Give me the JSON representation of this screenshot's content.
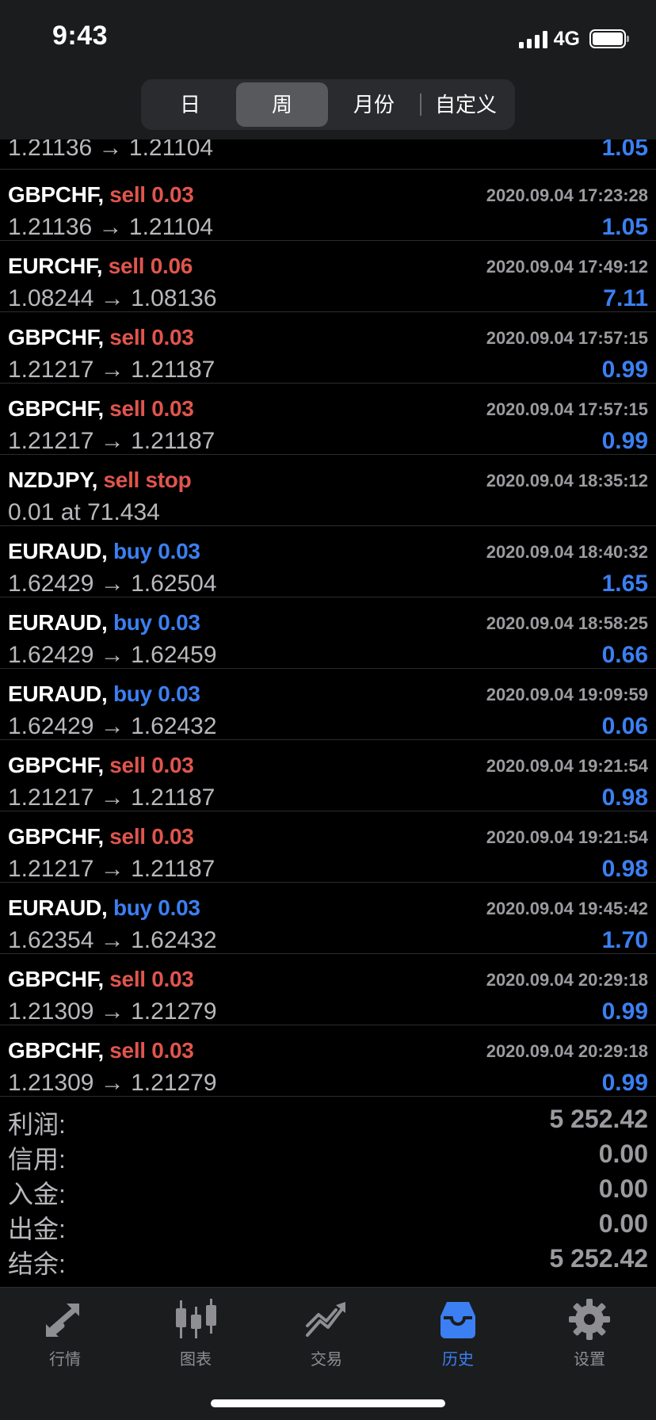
{
  "status_bar": {
    "time": "9:43",
    "network": "4G",
    "battery_level": 1.0
  },
  "period_tabs": {
    "selected": "周",
    "items": [
      {
        "label": "日"
      },
      {
        "label": "周"
      },
      {
        "label": "月份"
      },
      {
        "label": "自定义"
      }
    ]
  },
  "colors": {
    "sell": "#e0554d",
    "buy": "#3b7ff2",
    "profit": "#3b7ff2",
    "active_tab": "#3b7ff2",
    "background": "#000000"
  },
  "history": {
    "partial_top_row": {
      "prices": "1.21136 → 1.21104",
      "profit": "1.05"
    },
    "rows": [
      {
        "symbol": "GBPCHF,",
        "side": "sell 0.03",
        "type": "sell",
        "time": "2020.09.04 17:23:28",
        "prices": "1.21136 → 1.21104",
        "profit": "1.05"
      },
      {
        "symbol": "EURCHF,",
        "side": "sell 0.06",
        "type": "sell",
        "time": "2020.09.04 17:49:12",
        "prices": "1.08244 → 1.08136",
        "profit": "7.11"
      },
      {
        "symbol": "GBPCHF,",
        "side": "sell 0.03",
        "type": "sell",
        "time": "2020.09.04 17:57:15",
        "prices": "1.21217 → 1.21187",
        "profit": "0.99"
      },
      {
        "symbol": "GBPCHF,",
        "side": "sell 0.03",
        "type": "sell",
        "time": "2020.09.04 17:57:15",
        "prices": "1.21217 → 1.21187",
        "profit": "0.99"
      },
      {
        "symbol": "NZDJPY,",
        "side": "sell stop",
        "type": "sell",
        "time": "2020.09.04 18:35:12",
        "prices": "0.01 at 71.434",
        "profit": ""
      },
      {
        "symbol": "EURAUD,",
        "side": "buy 0.03",
        "type": "buy",
        "time": "2020.09.04 18:40:32",
        "prices": "1.62429 → 1.62504",
        "profit": "1.65"
      },
      {
        "symbol": "EURAUD,",
        "side": "buy 0.03",
        "type": "buy",
        "time": "2020.09.04 18:58:25",
        "prices": "1.62429 → 1.62459",
        "profit": "0.66"
      },
      {
        "symbol": "EURAUD,",
        "side": "buy 0.03",
        "type": "buy",
        "time": "2020.09.04 19:09:59",
        "prices": "1.62429 → 1.62432",
        "profit": "0.06"
      },
      {
        "symbol": "GBPCHF,",
        "side": "sell 0.03",
        "type": "sell",
        "time": "2020.09.04 19:21:54",
        "prices": "1.21217 → 1.21187",
        "profit": "0.98"
      },
      {
        "symbol": "GBPCHF,",
        "side": "sell 0.03",
        "type": "sell",
        "time": "2020.09.04 19:21:54",
        "prices": "1.21217 → 1.21187",
        "profit": "0.98"
      },
      {
        "symbol": "EURAUD,",
        "side": "buy 0.03",
        "type": "buy",
        "time": "2020.09.04 19:45:42",
        "prices": "1.62354 → 1.62432",
        "profit": "1.70"
      },
      {
        "symbol": "GBPCHF,",
        "side": "sell 0.03",
        "type": "sell",
        "time": "2020.09.04 20:29:18",
        "prices": "1.21309 → 1.21279",
        "profit": "0.99"
      },
      {
        "symbol": "GBPCHF,",
        "side": "sell 0.03",
        "type": "sell",
        "time": "2020.09.04 20:29:18",
        "prices": "1.21309 → 1.21279",
        "profit": "0.99"
      }
    ]
  },
  "summary": {
    "profit": {
      "label": "利润:",
      "value": "5 252.42"
    },
    "credit": {
      "label": "信用:",
      "value": "0.00"
    },
    "deposit": {
      "label": "入金:",
      "value": "0.00"
    },
    "withdrawal": {
      "label": "出金:",
      "value": "0.00"
    },
    "balance": {
      "label": "结余:",
      "value": "5 252.42"
    }
  },
  "tab_bar": {
    "active": "history",
    "items": [
      {
        "id": "quotes",
        "label": "行情",
        "icon": "quotes-arrows-icon"
      },
      {
        "id": "charts",
        "label": "图表",
        "icon": "candlestick-icon"
      },
      {
        "id": "trade",
        "label": "交易",
        "icon": "trade-trend-icon"
      },
      {
        "id": "history",
        "label": "历史",
        "icon": "history-inbox-icon"
      },
      {
        "id": "settings",
        "label": "设置",
        "icon": "gear-icon"
      }
    ]
  }
}
